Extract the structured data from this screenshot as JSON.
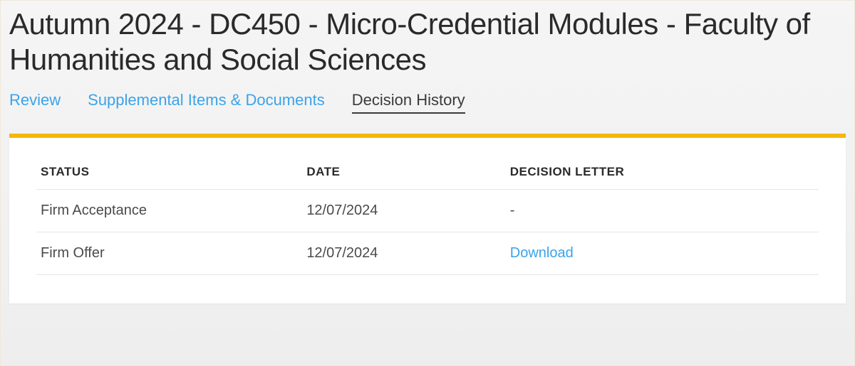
{
  "page_title": "Autumn 2024 - DC450 - Micro-Credential Modules - Faculty of Humanities and Social Sciences",
  "tabs": [
    {
      "label": "Review",
      "active": false
    },
    {
      "label": "Supplemental Items & Documents",
      "active": false
    },
    {
      "label": "Decision History",
      "active": true
    }
  ],
  "table": {
    "headers": {
      "status": "STATUS",
      "date": "DATE",
      "decision_letter": "DECISION LETTER"
    },
    "rows": [
      {
        "status": "Firm Acceptance",
        "date": "12/07/2024",
        "letter": "-",
        "letter_is_link": false
      },
      {
        "status": "Firm Offer",
        "date": "12/07/2024",
        "letter": "Download",
        "letter_is_link": true
      }
    ]
  }
}
